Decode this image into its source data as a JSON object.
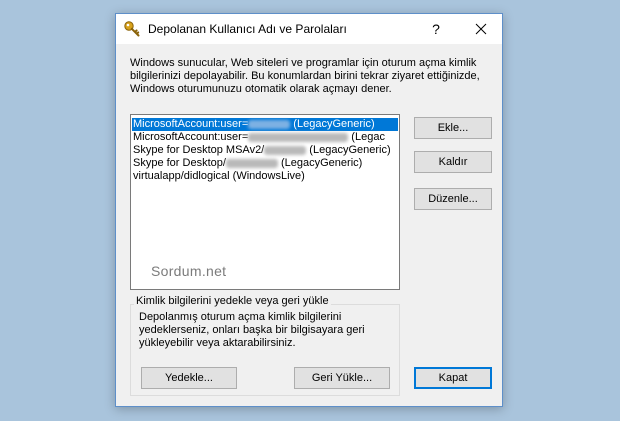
{
  "window": {
    "title": "Depolanan Kullanıcı Adı ve Parolaları",
    "help": "?"
  },
  "intro": "Windows sunucular, Web siteleri ve programlar için oturum açma kimlik bilgilerinizi depolayabilir. Bu konumlardan birini tekrar ziyaret ettiğinizde, Windows oturumunuzu otomatik olarak açmayı dener.",
  "credentials": [
    {
      "prefix": "MicrosoftAccount:user=",
      "suffix": " (LegacyGeneric)",
      "selected": true
    },
    {
      "prefix": "MicrosoftAccount:user=",
      "suffix": " (Legac",
      "selected": false
    },
    {
      "prefix": "Skype for Desktop MSAv2/",
      "suffix": " (LegacyGeneric)",
      "selected": false
    },
    {
      "prefix": "Skype for Desktop/",
      "suffix": " (LegacyGeneric)",
      "selected": false
    },
    {
      "prefix": "virtualapp/didlogical (WindowsLive)",
      "suffix": "",
      "selected": false
    }
  ],
  "watermark": "Sordum.net",
  "buttons": {
    "add": "Ekle...",
    "remove": "Kaldır",
    "edit": "Düzenle...",
    "backup": "Yedekle...",
    "restore": "Geri Yükle...",
    "close": "Kapat"
  },
  "backup_group": {
    "title": "Kimlik bilgilerini yedekle veya geri yükle",
    "text": "Depolanmış oturum açma kimlik bilgilerini yedeklerseniz, onları başka bir bilgisayara geri yükleyebilir veya aktarabilirsiniz."
  },
  "colors": {
    "background": "#a9c4dc",
    "selection": "#0078d7",
    "dialog": "#f0f0f0"
  }
}
